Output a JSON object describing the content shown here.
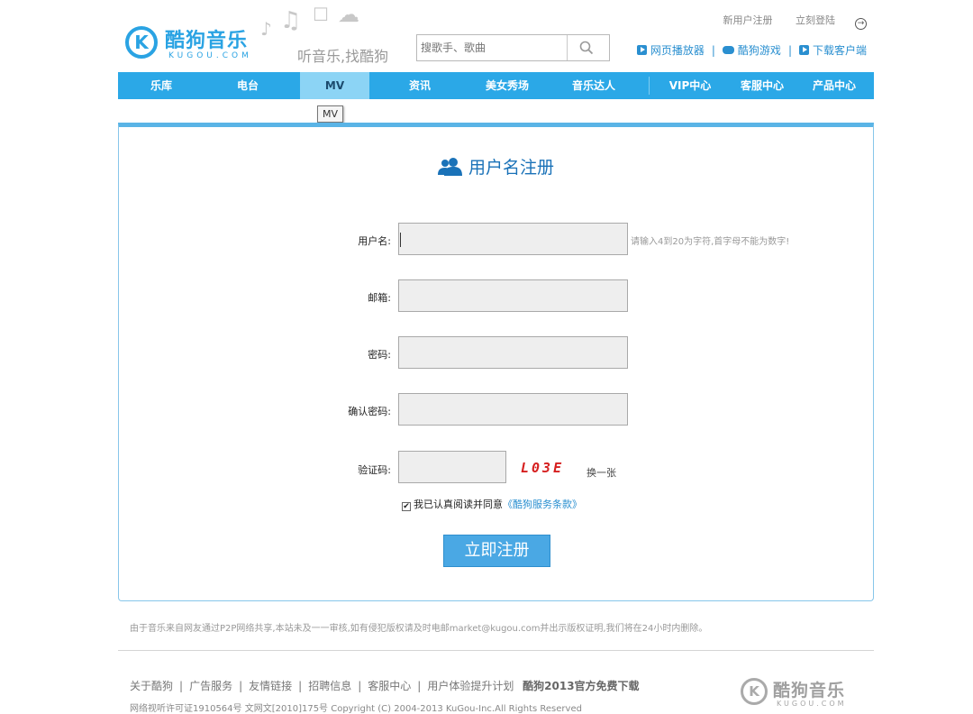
{
  "brand": {
    "logo_letter": "K",
    "name_cn": "酷狗音乐",
    "name_en": "KUGOU.COM",
    "slogan": "听音乐,找酷狗"
  },
  "search": {
    "placeholder": "搜歌手、歌曲"
  },
  "toplinks": {
    "register": "新用户注册",
    "login": "立刻登陆"
  },
  "quicklinks": [
    {
      "label": "网页播放器"
    },
    {
      "label": "酷狗游戏"
    },
    {
      "label": "下载客户端"
    }
  ],
  "nav": {
    "items": [
      {
        "label": "乐库"
      },
      {
        "label": "电台"
      },
      {
        "label": "MV"
      },
      {
        "label": "资讯"
      },
      {
        "label": "美女秀场"
      },
      {
        "label": "音乐达人"
      },
      {
        "label": "VIP中心"
      },
      {
        "label": "客服中心"
      },
      {
        "label": "产品中心"
      }
    ],
    "active_index": 2,
    "tooltip": "MV"
  },
  "form": {
    "title": "用户名注册",
    "fields": [
      {
        "label": "用户名:",
        "value": "",
        "hint": "请输入4到20为字符,首字母不能为数字!"
      },
      {
        "label": "邮箱:",
        "value": ""
      },
      {
        "label": "密码:",
        "value": ""
      },
      {
        "label": "确认密码:",
        "value": ""
      },
      {
        "label": "验证码:",
        "value": ""
      }
    ],
    "captcha_code": "L03E",
    "captcha_refresh": "换一张",
    "agree_text": "我已认真阅读并同意",
    "agree_link": "《酷狗服务条款》",
    "agree_checked": true,
    "submit_label": "立即注册"
  },
  "footer": {
    "disclaimer": "由于音乐来自网友通过P2P网络共享,本站未及一一审核,如有侵犯版权请及时电邮market@kugou.com并出示版权证明,我们将在24小时内删除。",
    "links": [
      "关于酷狗",
      "广告服务",
      "友情链接",
      "招聘信息",
      "客服中心",
      "用户体验提升计划"
    ],
    "download_label": "酷狗2013官方免费下载",
    "copyright": "网络视听许可证1910564号 文网文[2010]175号 Copyright (C) 2004-2013 KuGou-Inc.All Rights Reserved",
    "logo_letter": "K",
    "logo_cn": "酷狗音乐",
    "logo_en": "KUGOU.COM"
  },
  "colors": {
    "accent": "#2ba8e7",
    "nav_active": "#8cd4f5",
    "link": "#2a8fd0",
    "captcha": "#d61f1f"
  }
}
